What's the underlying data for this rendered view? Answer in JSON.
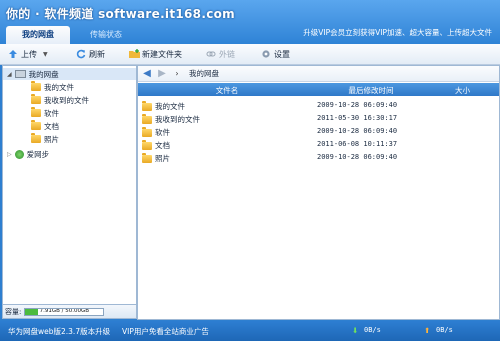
{
  "watermark": "你的 · 软件频道 software.it168.com",
  "promo_text": "升级VIP会员立刻获得VIP加速、超大容量、上传超大文件",
  "tabs": [
    {
      "label": "我的网盘",
      "active": true
    },
    {
      "label": "传输状态",
      "active": false
    }
  ],
  "toolbar": {
    "upload": "上传",
    "refresh": "刷新",
    "new_folder": "新建文件夹",
    "external_link": "外链",
    "settings": "设置"
  },
  "tree": {
    "root": "我的网盘",
    "children": [
      "我的文件",
      "我收到的文件",
      "软件",
      "文档",
      "照片"
    ],
    "other": "爱网步"
  },
  "storage": {
    "label": "容量:",
    "value": "7.91GB / 50.00GB",
    "fraction": 0.158
  },
  "breadcrumb": "我的网盘",
  "table": {
    "columns": [
      "文件名",
      "最后修改时间",
      "大小"
    ],
    "rows": [
      {
        "name": "我的文件",
        "modified": "2009-10-28 06:09:40",
        "size": "",
        "icon": "my-files"
      },
      {
        "name": "我收到的文件",
        "modified": "2011-05-30 16:30:17",
        "size": "",
        "icon": "received-files"
      },
      {
        "name": "软件",
        "modified": "2009-10-28 06:09:40",
        "size": "",
        "icon": "folder"
      },
      {
        "name": "文档",
        "modified": "2011-06-08 10:11:37",
        "size": "",
        "icon": "folder"
      },
      {
        "name": "照片",
        "modified": "2009-10-28 06:09:40",
        "size": "",
        "icon": "folder"
      }
    ]
  },
  "status": {
    "version": "华为网盘web版2.3.7版本升级",
    "ad": "VIP用户免看全站商业广告",
    "download_speed": "0B/s",
    "upload_speed": "0B/s"
  },
  "colors": {
    "accent": "#2f83d6",
    "download_arrow": "#4cbb3e",
    "upload_arrow": "#f0a020"
  }
}
